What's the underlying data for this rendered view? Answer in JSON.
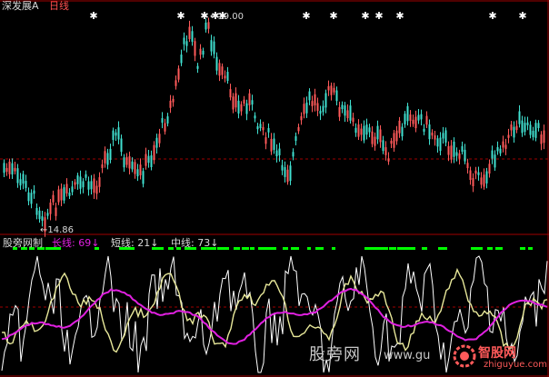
{
  "top_chart": {
    "title": "深发展A",
    "period": "日线",
    "high_label": "←19.00",
    "low_label": "←14.86"
  },
  "bottom_chart": {
    "title": "股旁网制",
    "long": {
      "label": "长线:",
      "value": "69↓"
    },
    "short": {
      "label": "短线:",
      "value": "21↓"
    },
    "mid": {
      "label": "中线:",
      "value": "73↓"
    }
  },
  "watermark": {
    "site_name": "股旁网",
    "site_url": "www.gu",
    "brand_cn": "智股网",
    "brand_url": "zhiguyue.com"
  },
  "colors": {
    "up_candle": "#ff5a5a",
    "down_candle": "#40e0d0",
    "long_line": "#e020e0",
    "short_line": "#ffffff",
    "mid_line": "#e8e89a",
    "signal": "#00ff00",
    "grid": "#a00000"
  },
  "icons": [
    "star-marker-icon",
    "gear-logo-icon"
  ]
}
